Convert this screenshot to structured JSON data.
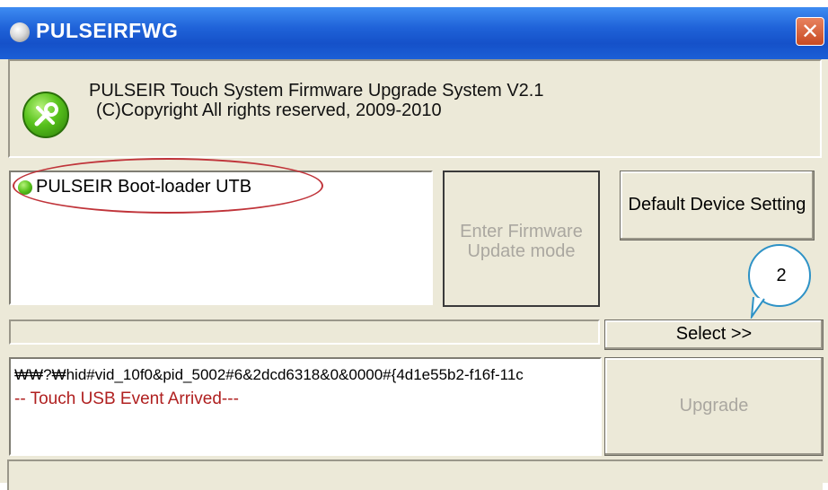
{
  "window": {
    "title": "PULSEIRFWG",
    "close_label": "✕"
  },
  "header": {
    "line1": "PULSEIR Touch System Firmware Upgrade System V2.1",
    "line2": "(C)Copyright All rights reserved, 2009-2010"
  },
  "device_list": {
    "items": [
      {
        "label": "PULSEIR Boot-loader UTB"
      }
    ]
  },
  "buttons": {
    "enter_firmware": "Enter Firmware Update mode",
    "default_device": "Default Device Setting",
    "select": "Select >>",
    "upgrade": "Upgrade"
  },
  "annotation": {
    "step": "2"
  },
  "path_field": {
    "value": ""
  },
  "log": {
    "lines": [
      "₩₩?₩hid#vid_10f0&pid_5002#6&2dcd6318&0&0000#{4d1e55b2-f16f-11c",
      "-- Touch USB Event Arrived---"
    ]
  },
  "status_bar": {
    "text": ""
  },
  "icons": {
    "title": "app-small-icon",
    "app": "wrench-icon",
    "device": "device-icon"
  },
  "colors": {
    "titlebar": "#1f62d8",
    "log_event": "#b02020",
    "annotation_oval": "#c0343a",
    "bubble": "#2e92c6"
  }
}
